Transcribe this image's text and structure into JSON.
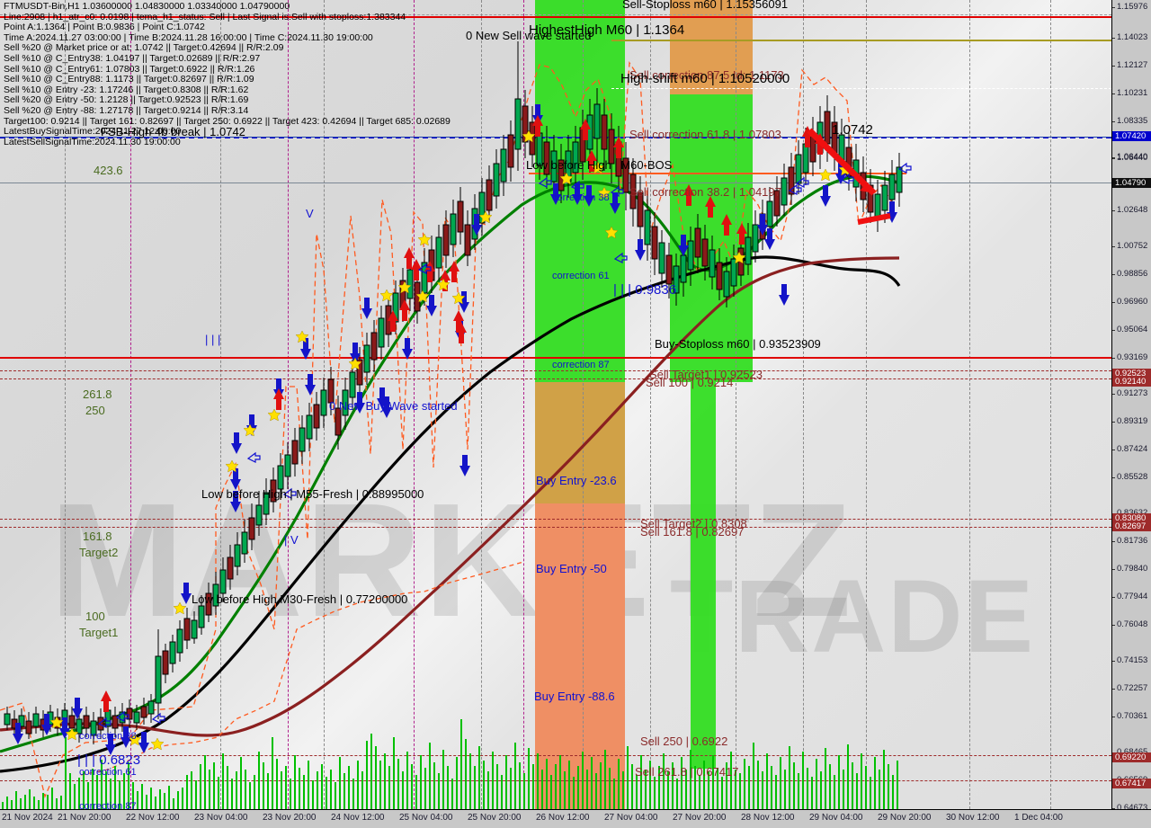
{
  "header": {
    "lines": [
      "FTMUSDT-Bin,H1  1.03600000 1.04830000 1.03340000 1.04790000",
      "Line:2908 | h1_atr_c0: 0.0198 | tema_h1_status: Sell | Last Signal is:Sell with stoploss:1.383344",
      "Point A:1.1364 | Point B:0.9836 | Point C:1.0742",
      "Time A:2024.11.27 03:00:00 | Time B:2024.11.28 16:00:00 | Time C:2024.11.30 19:00:00",
      "Sell %20 @ Market price or at: 1.0742 || Target:0.42694 || R/R:2.09",
      "Sell %10 @ C_Entry38: 1.04197 || Target:0.02689 || R/R:2.97",
      "Sell %10 @ C_Entry61: 1.07803 || Target:0.6922 || R/R:1.26",
      "Sell %10 @ C_Entry88: 1.1173 || Target:0.82697 || R/R:1.09",
      "Sell %10 @ Entry -23: 1.17246 || Target:0.8308 || R/R:1.62",
      "Sell %20 @ Entry -50: 1.2128 || Target:0.92523 || R/R:1.69",
      "Sell %20 @ Entry -88: 1.27178 || Target:0.9214 || R/R:3.14",
      "Target100: 0.9214 || Target 161: 0.82697 || Target 250: 0.6922 || Target 423: 0.42694 || Target 685: 0.02689",
      "LatestBuySignalTime:2024.11.27 12:00:00",
      "LatestSellSignalTime:2024.11.30 19:00:00"
    ]
  },
  "symbol": {
    "name": "FTMUSDT-Bin",
    "timeframe": "H1",
    "open": "1.03600000",
    "high": "1.04830000",
    "low": "1.03340000",
    "close": "1.04790000"
  },
  "watermark": {
    "text_a": "MARKETZ",
    "text_b": "TRADE",
    "full": "MARKETZ TRADE"
  },
  "chart_data": {
    "type": "line",
    "title": "FTMUSDT-Bin,H1",
    "xlabel": "",
    "ylabel": "",
    "grid": true,
    "legend": "none",
    "ylim": [
      0.64673,
      1.15976
    ],
    "xlim": [
      "21 Nov 2024",
      "1 Dec 04:00"
    ],
    "price_ticks": [
      "1.15976",
      "1.14023",
      "1.12127",
      "1.10231",
      "1.08335",
      "1.06440",
      "1.04790",
      "1.02648",
      "1.00752",
      "0.98856",
      "0.96960",
      "0.95064",
      "0.93169",
      "0.91273",
      "0.89319",
      "0.87424",
      "0.85528",
      "0.83632",
      "0.81736",
      "0.79840",
      "0.77944",
      "0.76048",
      "0.74153",
      "0.72257",
      "0.70361",
      "0.68465",
      "0.66569",
      "0.64673"
    ],
    "price_tags": [
      {
        "value": "1.07420",
        "style": "blue"
      },
      {
        "value": "1.04790",
        "style": "black"
      },
      {
        "value": "0.92523",
        "style": "red"
      },
      {
        "value": "0.92140",
        "style": "red"
      },
      {
        "value": "0.83080",
        "style": "red"
      },
      {
        "value": "0.82697",
        "style": "red"
      },
      {
        "value": "0.69220",
        "style": "red"
      },
      {
        "value": "0.67417",
        "style": "red"
      }
    ],
    "time_ticks": [
      "21 Nov 2024",
      "21 Nov 20:00",
      "22 Nov 12:00",
      "23 Nov 04:00",
      "23 Nov 20:00",
      "24 Nov 12:00",
      "25 Nov 04:00",
      "25 Nov 20:00",
      "26 Nov 12:00",
      "27 Nov 04:00",
      "27 Nov 20:00",
      "28 Nov 12:00",
      "29 Nov 04:00",
      "29 Nov 20:00",
      "30 Nov 12:00",
      "1 Dec 04:00"
    ],
    "fib_levels": [
      {
        "label": "423.6",
        "price": 1.14
      },
      {
        "label": "261.8",
        "price": 0.9625
      },
      {
        "label": "250",
        "price": 0.9545
      },
      {
        "label": "161.8",
        "price": 0.851
      },
      {
        "label": "Target2",
        "price": 0.843
      },
      {
        "label": "100",
        "price": 0.7585
      },
      {
        "label": "Target1",
        "price": 0.7505
      }
    ],
    "annotations": [
      {
        "text": "0 New Sell wave started",
        "color": "black"
      },
      {
        "text": "HighestHigh  M60 | 1.1364",
        "color": "black"
      },
      {
        "text": "Sell-Stoploss m60 | 1.15356091",
        "color": "darkred"
      },
      {
        "text": "High-shift m60 | 1.10520000",
        "color": "black"
      },
      {
        "text": "Sell correction 87.5 Id: 1.1173",
        "color": "darkred"
      },
      {
        "text": "Sell correction 61.8 | 1.07803",
        "color": "darkred"
      },
      {
        "text": "Sell correction 38.2 | 1.04197",
        "color": "darkred"
      },
      {
        "text": "Low before High  | M60-BOS",
        "color": "black"
      },
      {
        "text": "1.0742",
        "color": "black"
      },
      {
        "text": "FSB-High 4b break | 1.0742",
        "color": "black"
      },
      {
        "text": "correction 38",
        "color": "blue"
      },
      {
        "text": "correction 61",
        "color": "blue"
      },
      {
        "text": "correction 87",
        "color": "blue"
      },
      {
        "text": "| | | 0.9836",
        "color": "blue"
      },
      {
        "text": "Buy-Stoploss m60 | 0.93523909",
        "color": "black"
      },
      {
        "text": "Sell Target1 | 0.92523",
        "color": "darkred"
      },
      {
        "text": "Sell 100 | 0.9214",
        "color": "darkred"
      },
      {
        "text": "Low before High  | M55-Fresh | 0.88995000",
        "color": "black"
      },
      {
        "text": "0 New Buy Wave started",
        "color": "blue"
      },
      {
        "text": "Sell Target2 | 0.8308",
        "color": "darkred"
      },
      {
        "text": "Sell 161.8 | 0.82697",
        "color": "darkred"
      },
      {
        "text": "Buy Entry -23.6",
        "color": "blue"
      },
      {
        "text": "Buy Entry -50",
        "color": "blue"
      },
      {
        "text": "Low before High   M30-Fresh | 0.77200000",
        "color": "black"
      },
      {
        "text": "Buy Entry -88.6",
        "color": "blue"
      },
      {
        "text": "Sell 250 | 0.6922",
        "color": "darkred"
      },
      {
        "text": "Sell 261.8 | 0.67417",
        "color": "darkred"
      },
      {
        "text": "| | | 0.6823",
        "color": "blue"
      }
    ]
  },
  "labels": {
    "new_sell_wave": "0 New Sell wave started",
    "highest_high": "HighestHigh  M60 | 1.1364",
    "sell_stoploss": "Sell-Stoploss m60 | 1.15356091",
    "high_shift": "High-shift m60 | 1.10520000",
    "sell_corr_875": "Sell correction 87.5 Id: 1.1173",
    "sell_corr_618": "Sell correction 61.8 | 1.07803",
    "sell_corr_382": "Sell correction 38.2 | 1.04197",
    "low_before_high_bos": "Low before High  | M60-BOS",
    "point_c": "1.0742",
    "fsb_break": "FSB-High 4b break | 1.0742",
    "corr38_a": "correction 38",
    "corr61_a": "correction 61",
    "corr87_a": "correction 87",
    "point_b": "| | | 0.9836",
    "buy_stoploss": "Buy-Stoploss m60 | 0.93523909",
    "sell_target1": "Sell Target1 | 0.92523",
    "sell_100": "Sell 100 | 0.9214",
    "low_before_high_m55": "Low before High  | M55-Fresh | 0.88995000",
    "new_buy_wave": "0 New Buy Wave started",
    "sell_target2": "Sell Target2 | 0.8308",
    "sell_1618": "Sell 161.8 | 0.82697",
    "buy_entry_236": "Buy Entry -23.6",
    "buy_entry_50": "Buy Entry -50",
    "low_before_high_m30": "Low before High   M30-Fresh | 0.77200000",
    "buy_entry_886": "Buy Entry -88.6",
    "sell_250": "Sell 250 | 0.6922",
    "sell_2618": "Sell 261.8 | 0.67417",
    "low_point": "| | | 0.6823",
    "corr38_b": "correction 38",
    "corr61_b": "correction 61",
    "corr87_b": "correction 87",
    "fib_4236": "423.6",
    "fib_2618": "261.8",
    "fib_250": "250",
    "fib_1618": "161.8",
    "fib_target2": "Target2",
    "fib_100": "100",
    "fib_target1": "Target1"
  },
  "colors": {
    "bull_candle": "#00a850",
    "bear_candle": "#8a1a1a",
    "ma_green": "#008000",
    "ma_black": "#000000",
    "ma_brown": "#8b2020",
    "buy_arrow": "#1414c8",
    "sell_arrow": "#e01010",
    "stop_line": "#e00000",
    "band_green": "#33dd22",
    "band_orange": "#e09a4a",
    "band_salmon": "#f58b6a",
    "volume": "#00c000",
    "fib_dash": "#9e2b2b",
    "price_tag_blue": "#0000cd"
  }
}
